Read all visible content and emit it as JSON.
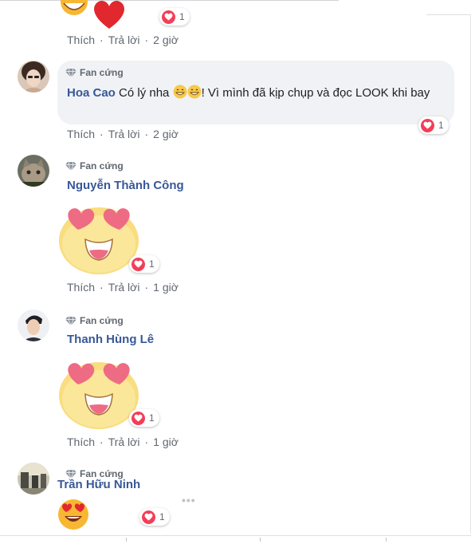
{
  "actions": {
    "like": "Thích",
    "reply": "Trả lời",
    "separator": "·"
  },
  "badge_label": "Fan cứng",
  "colors": {
    "link": "#385898",
    "muted": "#606770",
    "heart": "#f33e58",
    "bubble": "#f0f2f5"
  },
  "comments": [
    {
      "time": "2 giờ",
      "reactions": "1"
    },
    {
      "author": "Hoa Cao",
      "text_a": "Có lý nha",
      "text_b": "! Vì mình đã kịp chụp và đọc LOOK khi bay",
      "time": "2 giờ",
      "reactions": "1"
    },
    {
      "author": "Nguyễn Thành Công",
      "time": "1 giờ",
      "reactions": "1"
    },
    {
      "author": "Thanh Hùng Lê",
      "time": "1 giờ",
      "reactions": "1"
    },
    {
      "author": "Trần Hữu Ninh",
      "reactions": "1",
      "more": "•••"
    }
  ]
}
